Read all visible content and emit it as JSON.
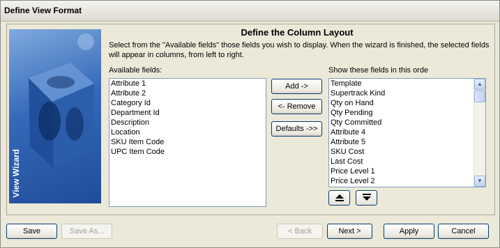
{
  "window": {
    "title": "Define View Format"
  },
  "side_panel": {
    "label": "View Wizard"
  },
  "heading": "Define the Column Layout",
  "instructions": "Select from the \"Available fields\" those fields you wish to display. When the wizard is finished, the selected fields will appear in columns, from left to right.",
  "available": {
    "label": "Available fields:",
    "items": [
      "Attribute 1",
      "Attribute 2",
      "Category Id",
      "Department Id",
      "Description",
      "Location",
      "SKU Item Code",
      "UPC Item Code"
    ]
  },
  "selected": {
    "label": "Show these fields in this orde",
    "items": [
      "Template",
      "Supertrack Kind",
      "Qty on Hand",
      "Qty Pending",
      "Qty Committed",
      "Attribute 4",
      "Attribute 5",
      "SKU Cost",
      "Last Cost",
      "Price Level 1",
      "Price Level 2"
    ]
  },
  "middle_buttons": {
    "add": "Add ->",
    "remove": "<- Remove",
    "defaults": "Defaults ->>"
  },
  "order_buttons": {
    "up_icon": "move-up-icon",
    "down_icon": "move-down-icon"
  },
  "footer": {
    "save": "Save",
    "save_as": "Save As...",
    "back": "< Back",
    "next": "Next >",
    "apply": "Apply",
    "cancel": "Cancel"
  },
  "colors": {
    "dialog_bg": "#ece9d8",
    "panel_blue": "#2f62b0",
    "border_blue": "#7f9db9"
  }
}
